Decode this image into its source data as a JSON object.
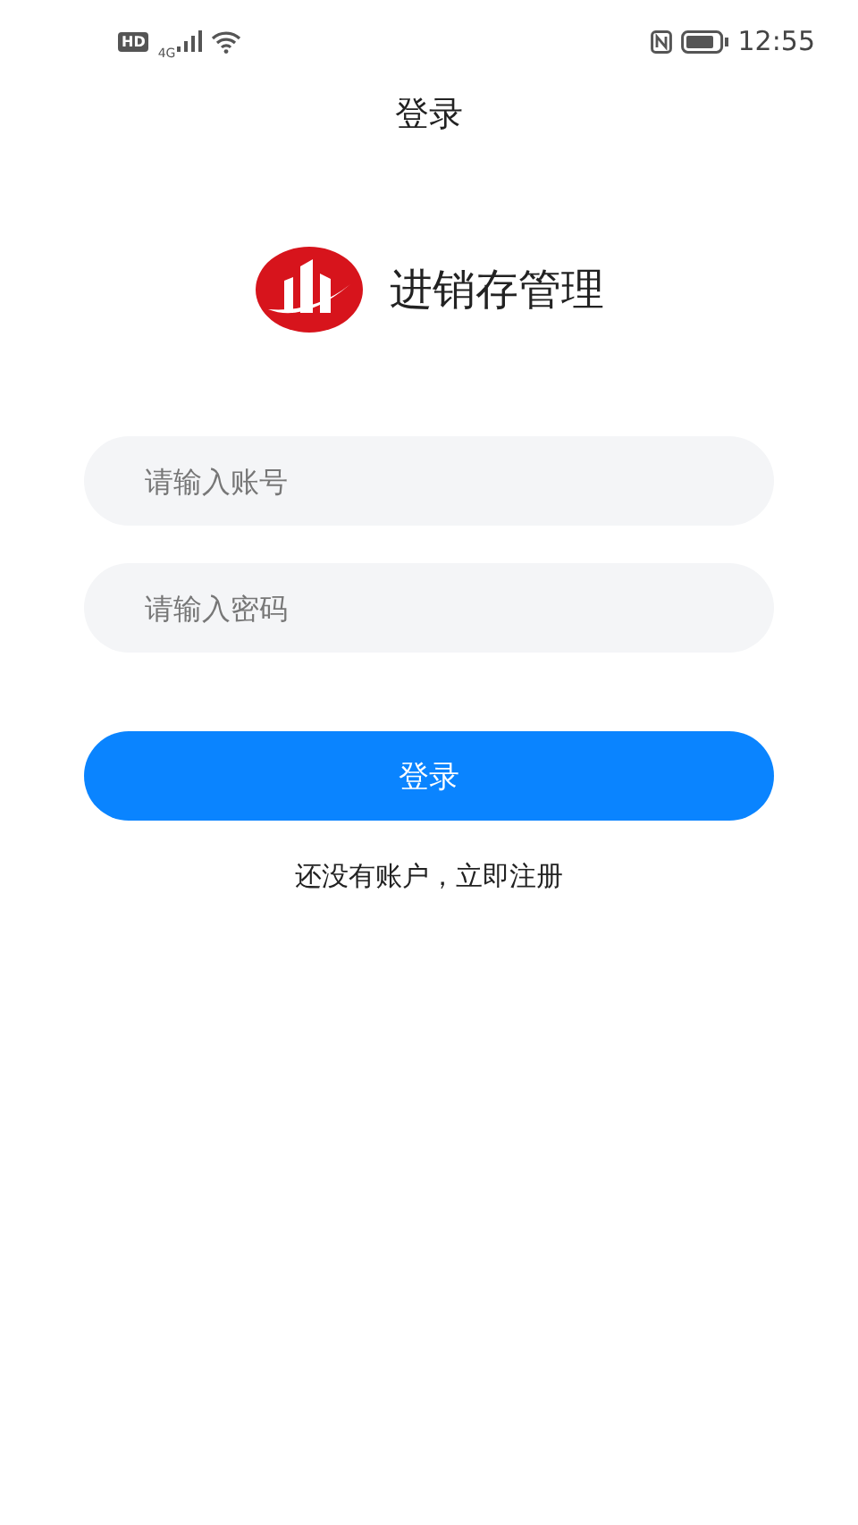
{
  "status_bar": {
    "hd": "HD",
    "network": "4G",
    "time": "12:55"
  },
  "header": {
    "title": "登录"
  },
  "brand": {
    "name": "进销存管理"
  },
  "fields": [
    {
      "placeholder": "请输入账号"
    },
    {
      "placeholder": "请输入密码"
    }
  ],
  "login_button": "登录",
  "register_link": "还没有账户，立即注册"
}
